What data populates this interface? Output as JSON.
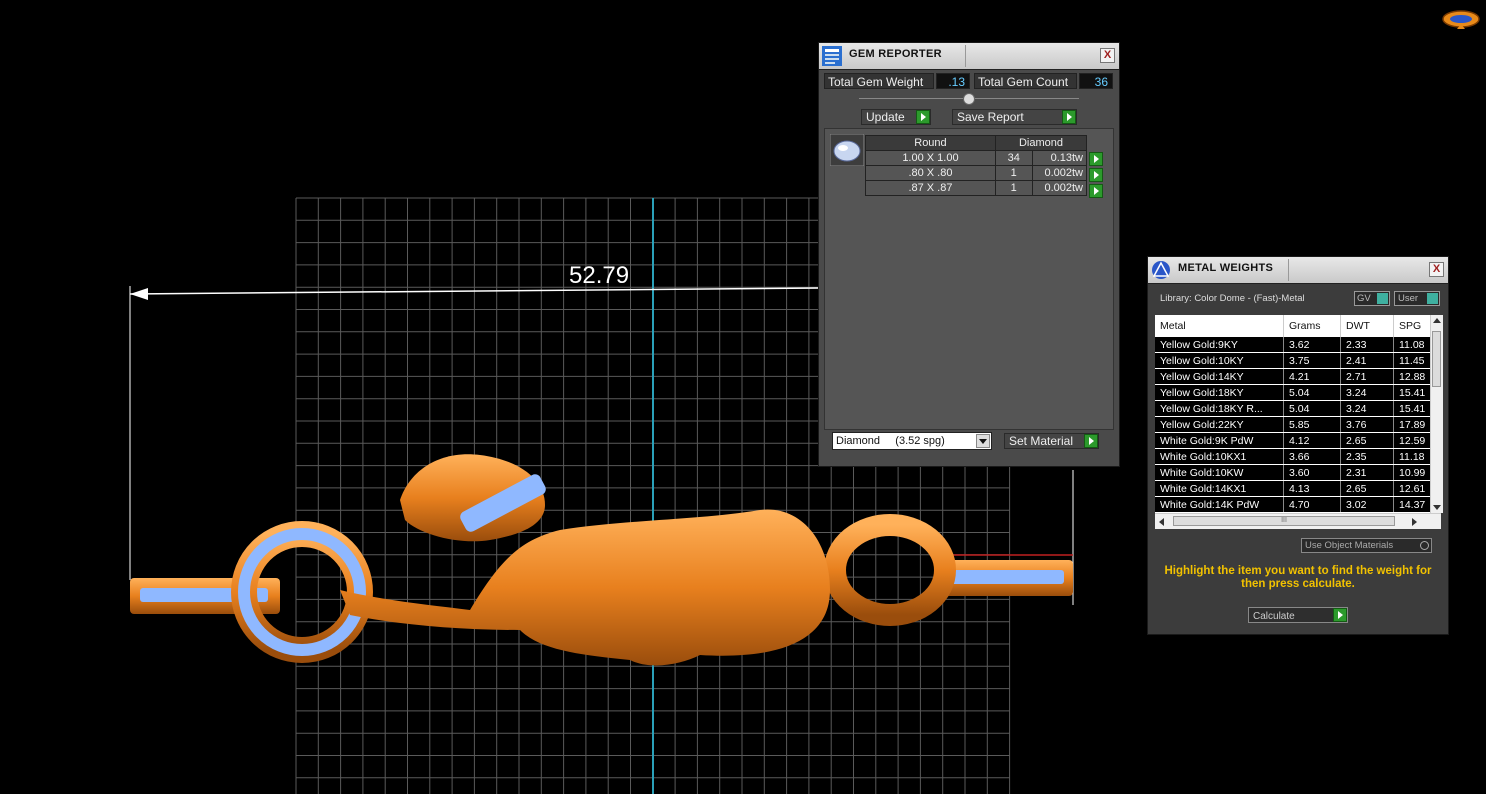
{
  "viewport": {
    "dimension_label": "52.79"
  },
  "gem_reporter": {
    "title": "GEM REPORTER",
    "close_label": "X",
    "total_weight_label": "Total Gem Weight",
    "total_weight_value": ".13",
    "total_count_label": "Total Gem Count",
    "total_count_value": "36",
    "update_label": "Update",
    "save_report_label": "Save Report",
    "shape_header": "Round",
    "material_header": "Diamond",
    "rows": [
      {
        "size": "1.00 X 1.00",
        "count": "34",
        "weight": "0.13tw"
      },
      {
        "size": ".80 X .80",
        "count": "1",
        "weight": "0.002tw"
      },
      {
        "size": ".87 X .87",
        "count": "1",
        "weight": "0.002tw"
      }
    ],
    "material_select_value": "Diamond     (3.52 spg)",
    "set_material_label": "Set Material"
  },
  "metal_weights": {
    "title": "METAL WEIGHTS",
    "close_label": "X",
    "library_label": "Library: Color Dome - (Fast)-Metal",
    "gv_label": "GV",
    "user_label": "User",
    "columns": [
      "Metal",
      "Grams",
      "DWT",
      "SPG"
    ],
    "rows": [
      [
        "Yellow Gold:9KY",
        "3.62",
        "2.33",
        "11.08"
      ],
      [
        "Yellow Gold:10KY",
        "3.75",
        "2.41",
        "11.45"
      ],
      [
        "Yellow Gold:14KY",
        "4.21",
        "2.71",
        "12.88"
      ],
      [
        "Yellow Gold:18KY",
        "5.04",
        "3.24",
        "15.41"
      ],
      [
        "Yellow Gold:18KY R...",
        "5.04",
        "3.24",
        "15.41"
      ],
      [
        "Yellow Gold:22KY",
        "5.85",
        "3.76",
        "17.89"
      ],
      [
        "White Gold:9K PdW",
        "4.12",
        "2.65",
        "12.59"
      ],
      [
        "White Gold:10KX1",
        "3.66",
        "2.35",
        "11.18"
      ],
      [
        "White Gold:10KW",
        "3.60",
        "2.31",
        "10.99"
      ],
      [
        "White Gold:14KX1",
        "4.13",
        "2.65",
        "12.61"
      ],
      [
        "White Gold:14K PdW",
        "4.70",
        "3.02",
        "14.37"
      ]
    ],
    "scroll_grip": "III",
    "use_object_label": "Use Object Materials",
    "hint_text": "Highlight the item you want to find the weight for then press calculate.",
    "calculate_label": "Calculate",
    "hint_color": "#f2c200"
  }
}
